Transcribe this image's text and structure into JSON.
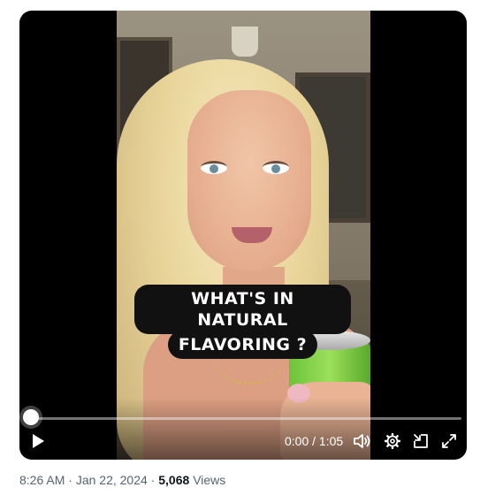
{
  "video": {
    "caption_line1": "WHAT'S IN NATURAL",
    "caption_line2": "FLAVORING ?",
    "progress": 0.0
  },
  "controls": {
    "play_icon": "play-icon",
    "time_current": "0:00",
    "time_separator": " / ",
    "time_total": "1:05",
    "volume_icon": "volume-icon",
    "settings_icon": "gear-icon",
    "pip_icon": "picture-in-picture-icon",
    "fullscreen_icon": "fullscreen-icon",
    "accent_color": "#1d9bf0"
  },
  "meta": {
    "time": "8:26 AM",
    "separator": " · ",
    "date": "Jan 22, 2024",
    "views_count": "5,068",
    "views_label": "Views"
  }
}
